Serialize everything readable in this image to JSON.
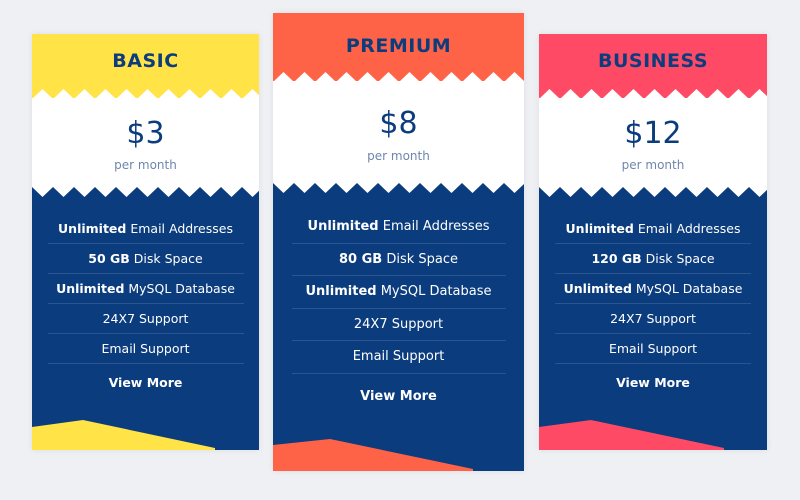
{
  "colors": {
    "background": "#eef0f4",
    "navy": "#0b3c7d",
    "basic_accent": "#ffe347",
    "premium_accent": "#ff6347",
    "business_accent": "#ff4a66"
  },
  "plans": [
    {
      "name": "BASIC",
      "price": "$3",
      "period": "per month",
      "features": [
        {
          "bold": "Unlimited",
          "text": " Email Addresses"
        },
        {
          "bold": "50 GB",
          "text": " Disk Space"
        },
        {
          "bold": "Unlimited",
          "text": " MySQL Database"
        },
        {
          "bold": "",
          "text": "24X7 Support"
        },
        {
          "bold": "",
          "text": "Email Support"
        }
      ],
      "cta": "View More"
    },
    {
      "name": "PREMIUM",
      "price": "$8",
      "period": "per month",
      "features": [
        {
          "bold": "Unlimited",
          "text": " Email Addresses"
        },
        {
          "bold": "80 GB",
          "text": " Disk Space"
        },
        {
          "bold": "Unlimited",
          "text": " MySQL Database"
        },
        {
          "bold": "",
          "text": "24X7 Support"
        },
        {
          "bold": "",
          "text": "Email Support"
        }
      ],
      "cta": "View More"
    },
    {
      "name": "BUSINESS",
      "price": "$12",
      "period": "per month",
      "features": [
        {
          "bold": "Unlimited",
          "text": " Email Addresses"
        },
        {
          "bold": "120 GB",
          "text": " Disk Space"
        },
        {
          "bold": "Unlimited",
          "text": " MySQL Database"
        },
        {
          "bold": "",
          "text": "24X7 Support"
        },
        {
          "bold": "",
          "text": "Email Support"
        }
      ],
      "cta": "View More"
    }
  ]
}
